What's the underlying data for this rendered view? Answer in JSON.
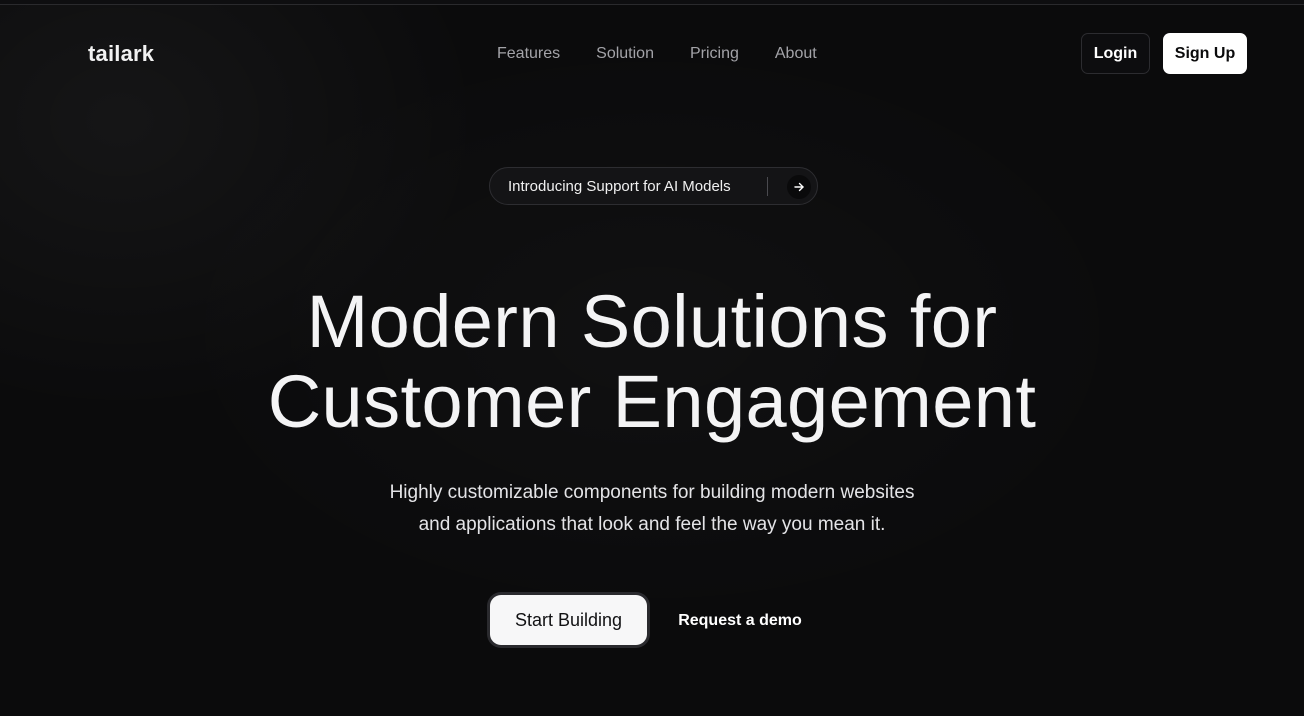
{
  "brand": {
    "name": "tailark",
    "logo_icon": "hash-grid-icon",
    "accent": "#5fb7d4"
  },
  "nav": {
    "items": [
      "Features",
      "Solution",
      "Pricing",
      "About"
    ]
  },
  "auth": {
    "login_label": "Login",
    "signup_label": "Sign Up"
  },
  "announcement": {
    "text": "Introducing Support for AI Models",
    "icon": "arrow-right-icon"
  },
  "hero": {
    "headline_line1": "Modern Solutions for",
    "headline_line2": "Customer Engagement",
    "sub_line1": "Highly customizable components for building modern websites",
    "sub_line2": "and applications that look and feel the way you mean it."
  },
  "cta": {
    "primary_label": "Start Building",
    "secondary_label": "Request a demo"
  },
  "colors": {
    "background": "#0b0b0c",
    "text": "#f4f4f5",
    "muted": "#a3a3a8",
    "button_light": "#ffffff"
  }
}
